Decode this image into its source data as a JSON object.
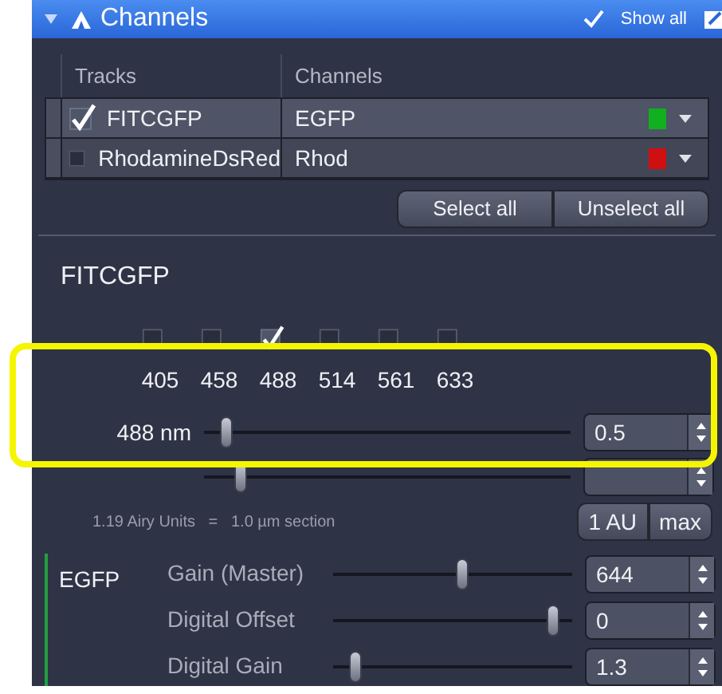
{
  "header": {
    "title": "Channels",
    "show_all": {
      "label": "Show all",
      "checked": true
    }
  },
  "tracks_table": {
    "columns": [
      "Tracks",
      "Channels"
    ],
    "rows": [
      {
        "track": "FITCGFP",
        "checked": true,
        "selected": true,
        "channel": "EGFP",
        "color": "#10b020"
      },
      {
        "track": "RhodamineDsRed",
        "checked": false,
        "selected": false,
        "channel": "Rhod",
        "color": "#d01010"
      }
    ]
  },
  "buttons": [
    "Select all",
    "Unselect all"
  ],
  "track_title": "FITCGFP",
  "lasers": [
    {
      "wavelength": "405",
      "checked": false
    },
    {
      "wavelength": "458",
      "checked": false
    },
    {
      "wavelength": "488",
      "checked": true
    },
    {
      "wavelength": "514",
      "checked": false
    },
    {
      "wavelength": "561",
      "checked": false
    },
    {
      "wavelength": "633",
      "checked": false
    }
  ],
  "laser_power": {
    "label": "488 nm",
    "level": 0.06,
    "value": "0.5"
  },
  "pinhole": {
    "level": 0.1
  },
  "airy": "1.19 Airy Units   =   1.0 µm section",
  "pinhole_buttons": [
    "1 AU",
    "max"
  ],
  "detector": {
    "channel": "EGFP",
    "color": "#22a040",
    "controls": [
      {
        "label": "Gain (Master)",
        "level": 0.54,
        "value": "644"
      },
      {
        "label": "Digital Offset",
        "level": 0.92,
        "value": "0"
      },
      {
        "label": "Digital Gain",
        "level": 0.09,
        "value": "1.3"
      }
    ]
  }
}
